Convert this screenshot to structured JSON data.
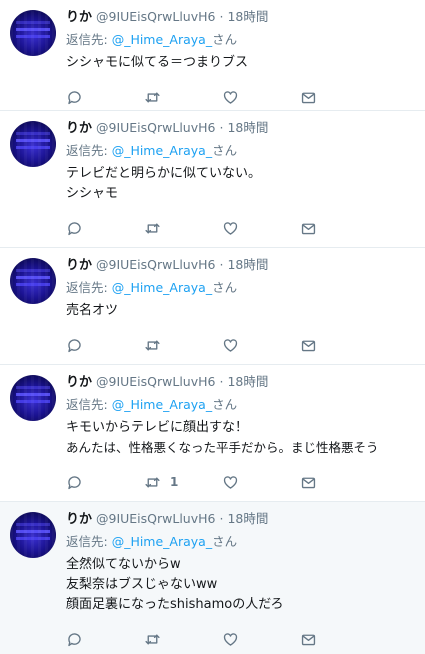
{
  "tweets": [
    {
      "name": "りか",
      "handle": "@9IUEisQrwLluvH6",
      "sep": "·",
      "time": "18時間",
      "reply_prefix": "返信先: ",
      "reply_mention": "@_Hime_Araya_",
      "reply_suffix": "さん",
      "lines": [
        "シシャモに似てる＝つまりブス"
      ],
      "retweets": ""
    },
    {
      "name": "りか",
      "handle": "@9IUEisQrwLluvH6",
      "sep": "·",
      "time": "18時間",
      "reply_prefix": "返信先: ",
      "reply_mention": "@_Hime_Araya_",
      "reply_suffix": "さん",
      "lines": [
        "テレビだと明らかに似ていない。",
        "シシャモ"
      ],
      "retweets": ""
    },
    {
      "name": "りか",
      "handle": "@9IUEisQrwLluvH6",
      "sep": "·",
      "time": "18時間",
      "reply_prefix": "返信先: ",
      "reply_mention": "@_Hime_Araya_",
      "reply_suffix": "さん",
      "lines": [
        "売名オツ"
      ],
      "retweets": ""
    },
    {
      "name": "りか",
      "handle": "@9IUEisQrwLluvH6",
      "sep": "·",
      "time": "18時間",
      "reply_prefix": "返信先: ",
      "reply_mention": "@_Hime_Araya_",
      "reply_suffix": "さん",
      "lines": [
        "キモいからテレビに顔出すな！",
        "あんたは、性格悪くなった平手だから。まじ性格悪そう"
      ],
      "retweets": "1"
    },
    {
      "name": "りか",
      "handle": "@9IUEisQrwLluvH6",
      "sep": "·",
      "time": "18時間",
      "reply_prefix": "返信先: ",
      "reply_mention": "@_Hime_Araya_",
      "reply_suffix": "さん",
      "lines": [
        "全然似てないからw",
        "友梨奈はブスじゃないww",
        "顔面足裏になったshishamoの人だろ"
      ],
      "retweets": ""
    }
  ],
  "icons": {
    "reply": "reply-icon",
    "retweet": "retweet-icon",
    "like": "heart-icon",
    "dm": "envelope-icon"
  },
  "colors": {
    "link": "#1da1f2",
    "secondary_text": "#657786",
    "highlight_bg": "#f5f8fa"
  }
}
